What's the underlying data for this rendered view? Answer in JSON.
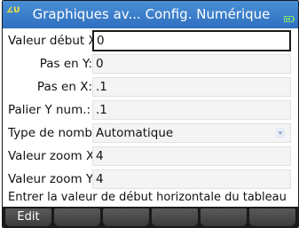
{
  "titlebar": {
    "title": "Graphiques av... Config. Numérique",
    "angle_indicator": "∡U",
    "battery_icon": "battery-icon"
  },
  "fields": [
    {
      "label": "Valeur début X",
      "value": "0",
      "active": true
    },
    {
      "label": "Pas en Y:",
      "value": "0"
    },
    {
      "label": "Pas en X:",
      "value": ".1"
    },
    {
      "label": "Palier Y num.:",
      "value": ".1"
    },
    {
      "label": "Type de nomb",
      "value": "Automatique",
      "dropdown": true
    },
    {
      "label": "Valeur zoom X",
      "value": "4"
    },
    {
      "label": "Valeur zoom Y",
      "value": "4"
    }
  ],
  "hint": "Entrer la valeur de début horizontale du tableau",
  "softkeys": [
    "Edit",
    "",
    "",
    "",
    "",
    ""
  ],
  "colors": {
    "titlebar": "#3a7fcc",
    "angle": "#f5e23a",
    "softkey_bar": "#1a1a1a"
  }
}
